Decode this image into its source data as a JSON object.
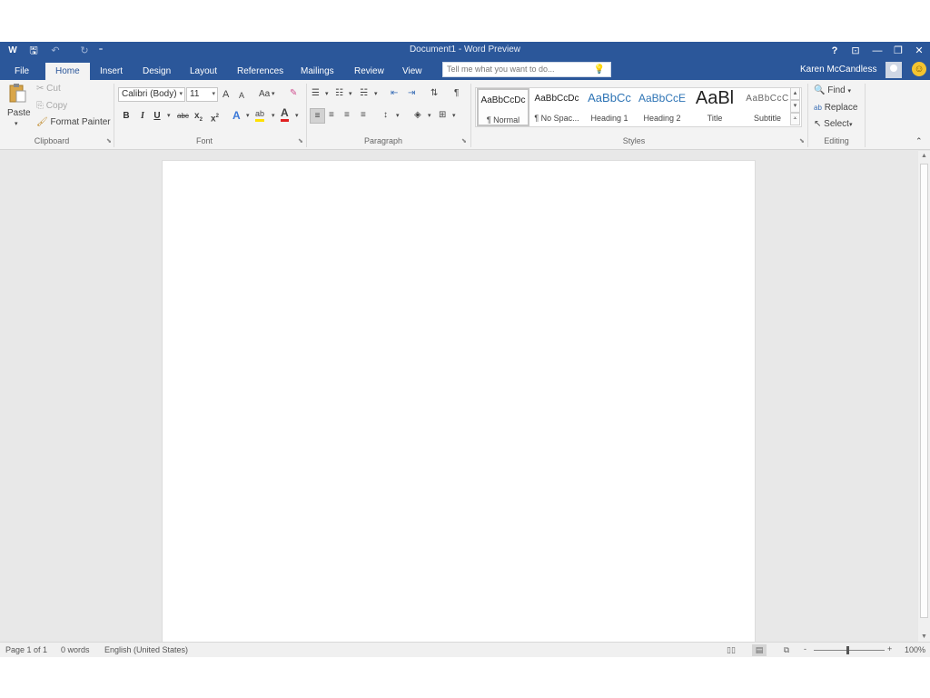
{
  "window": {
    "title": "Document1 - Word Preview",
    "app_icon": "W",
    "help": "?",
    "ribbon_display": "⊡",
    "minimize": "—",
    "restore": "❐",
    "close": "✕"
  },
  "quick_access": {
    "save": "🖫",
    "undo": "↶",
    "redo": "↻",
    "customize": "⁼"
  },
  "tabs": [
    "File",
    "Home",
    "Insert",
    "Design",
    "Layout",
    "References",
    "Mailings",
    "Review",
    "View"
  ],
  "tell_me": {
    "placeholder": "Tell me what you want to do..."
  },
  "user": {
    "name": "Karen McCandless"
  },
  "clipboard": {
    "paste": "Paste",
    "cut": "Cut",
    "copy": "Copy",
    "format_painter": "Format Painter",
    "label": "Clipboard"
  },
  "font": {
    "name": "Calibri (Body)",
    "size": "11",
    "grow": "A",
    "shrink": "A",
    "change_case": "Aa",
    "bold": "B",
    "italic": "I",
    "underline": "U",
    "strike": "abc",
    "subscript": "x",
    "superscript": "x",
    "effects": "A",
    "highlight": "ab",
    "color": "A",
    "label": "Font"
  },
  "paragraph": {
    "label": "Paragraph",
    "pilcrow": "¶"
  },
  "styles": {
    "label": "Styles",
    "items": [
      {
        "sample": "AaBbCcDc",
        "name": "¶ Normal"
      },
      {
        "sample": "AaBbCcDc",
        "name": "¶ No Spac..."
      },
      {
        "sample": "AaBbCc",
        "name": "Heading 1"
      },
      {
        "sample": "AaBbCcE",
        "name": "Heading 2"
      },
      {
        "sample": "AaBl",
        "name": "Title"
      },
      {
        "sample": "AaBbCcC",
        "name": "Subtitle"
      }
    ]
  },
  "editing": {
    "find": "Find",
    "replace": "Replace",
    "select": "Select",
    "label": "Editing"
  },
  "statusbar": {
    "page": "Page 1 of 1",
    "words": "0 words",
    "language": "English (United States)",
    "zoom": "100%",
    "zoom_minus": "-",
    "zoom_plus": "+"
  },
  "colors": {
    "accent": "#2b579a",
    "font_color": "#e02020",
    "highlight": "#ffe000"
  }
}
